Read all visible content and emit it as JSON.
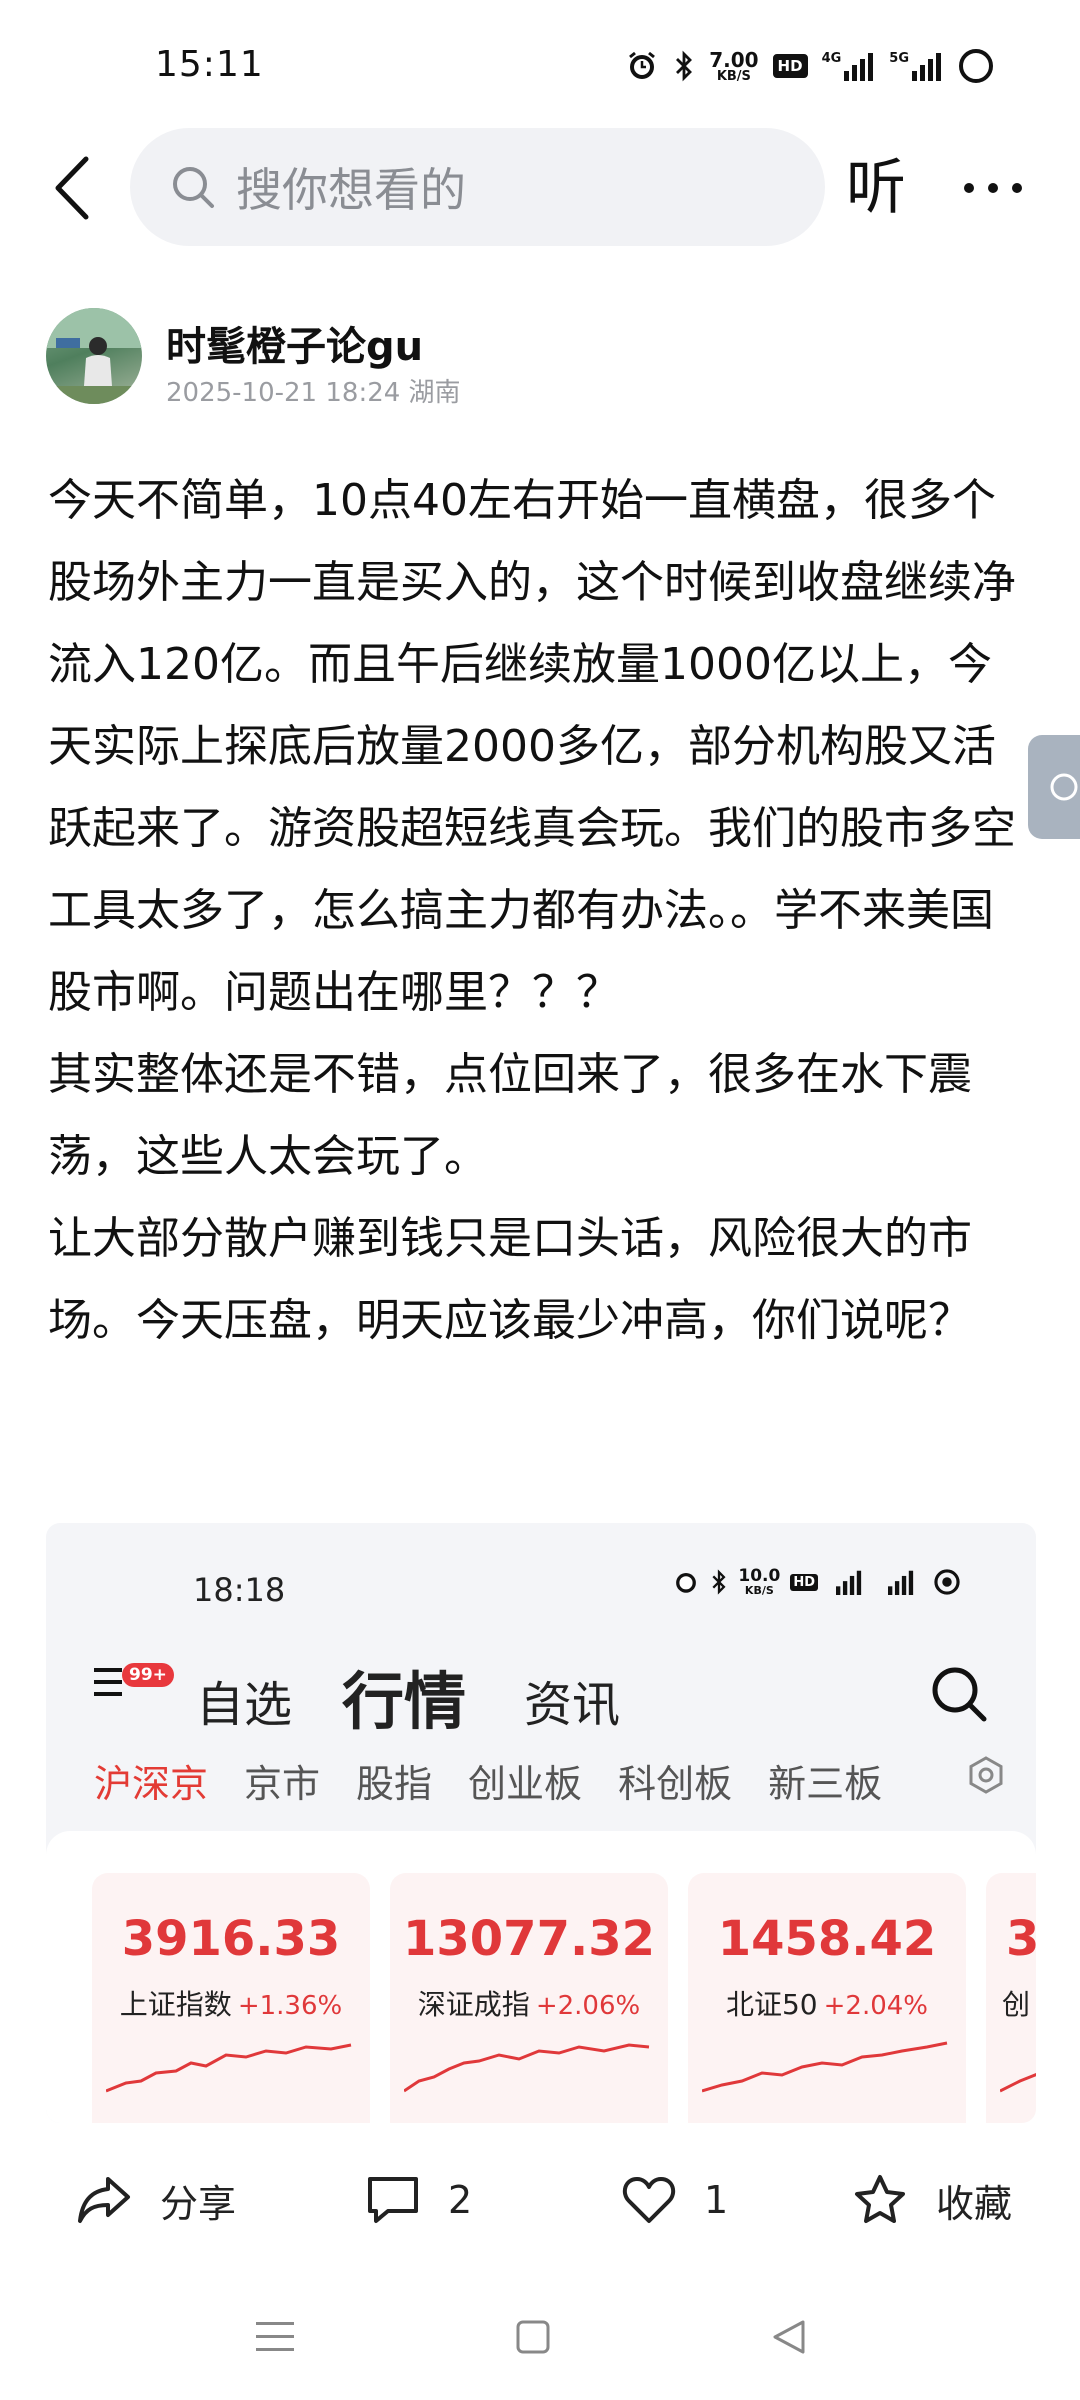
{
  "status_bar": {
    "time": "15:11",
    "net_speed_value": "7.00",
    "net_speed_unit": "KB/S",
    "hd_label": "HD",
    "signal1_label": "4G",
    "signal2_label": "5G"
  },
  "header": {
    "search_placeholder": "搜你想看的",
    "listen_label": "听"
  },
  "author": {
    "name": "时髦橙子论gu",
    "meta": "2025-10-21 18:24 湖南"
  },
  "post": {
    "paragraphs": [
      "今天不简单，10点40左右开始一直横盘，很多个股场外主力一直是买入的，这个时候到收盘继续净流入120亿。而且午后继续放量1000亿以上，今天实际上探底后放量2000多亿，部分机构股又活跃起来了。游资股超短线真会玩。我们的股市多空工具太多了，怎么搞主力都有办法。。学不来美国股市啊。问题出在哪里？？？",
      "其实整体还是不错，点位回来了，很多在水下震荡，这些人太会玩了。",
      "让大部分散户赚到钱只是口头话，风险很大的市场。今天压盘，明天应该最少冲高，你们说呢？"
    ]
  },
  "embed": {
    "time": "18:18",
    "net_speed_value": "10.0",
    "net_speed_unit": "KB/S",
    "badge": "99+",
    "tabs": [
      "自选",
      "行情",
      "资讯"
    ],
    "subtabs": [
      "沪深京",
      "京市",
      "股指",
      "创业板",
      "科创板",
      "新三板"
    ],
    "indices": [
      {
        "value": "3916.33",
        "name": "上证指数",
        "change": "+1.36%"
      },
      {
        "value": "13077.32",
        "name": "深证成指",
        "change": "+2.06%"
      },
      {
        "value": "1458.42",
        "name": "北证50",
        "change": "+2.04%"
      },
      {
        "value": "3",
        "name": "创",
        "change": ""
      }
    ],
    "accent_color": "#e0383a"
  },
  "actions": {
    "share_label": "分享",
    "comment_count": "2",
    "like_count": "1",
    "favorite_label": "收藏"
  }
}
